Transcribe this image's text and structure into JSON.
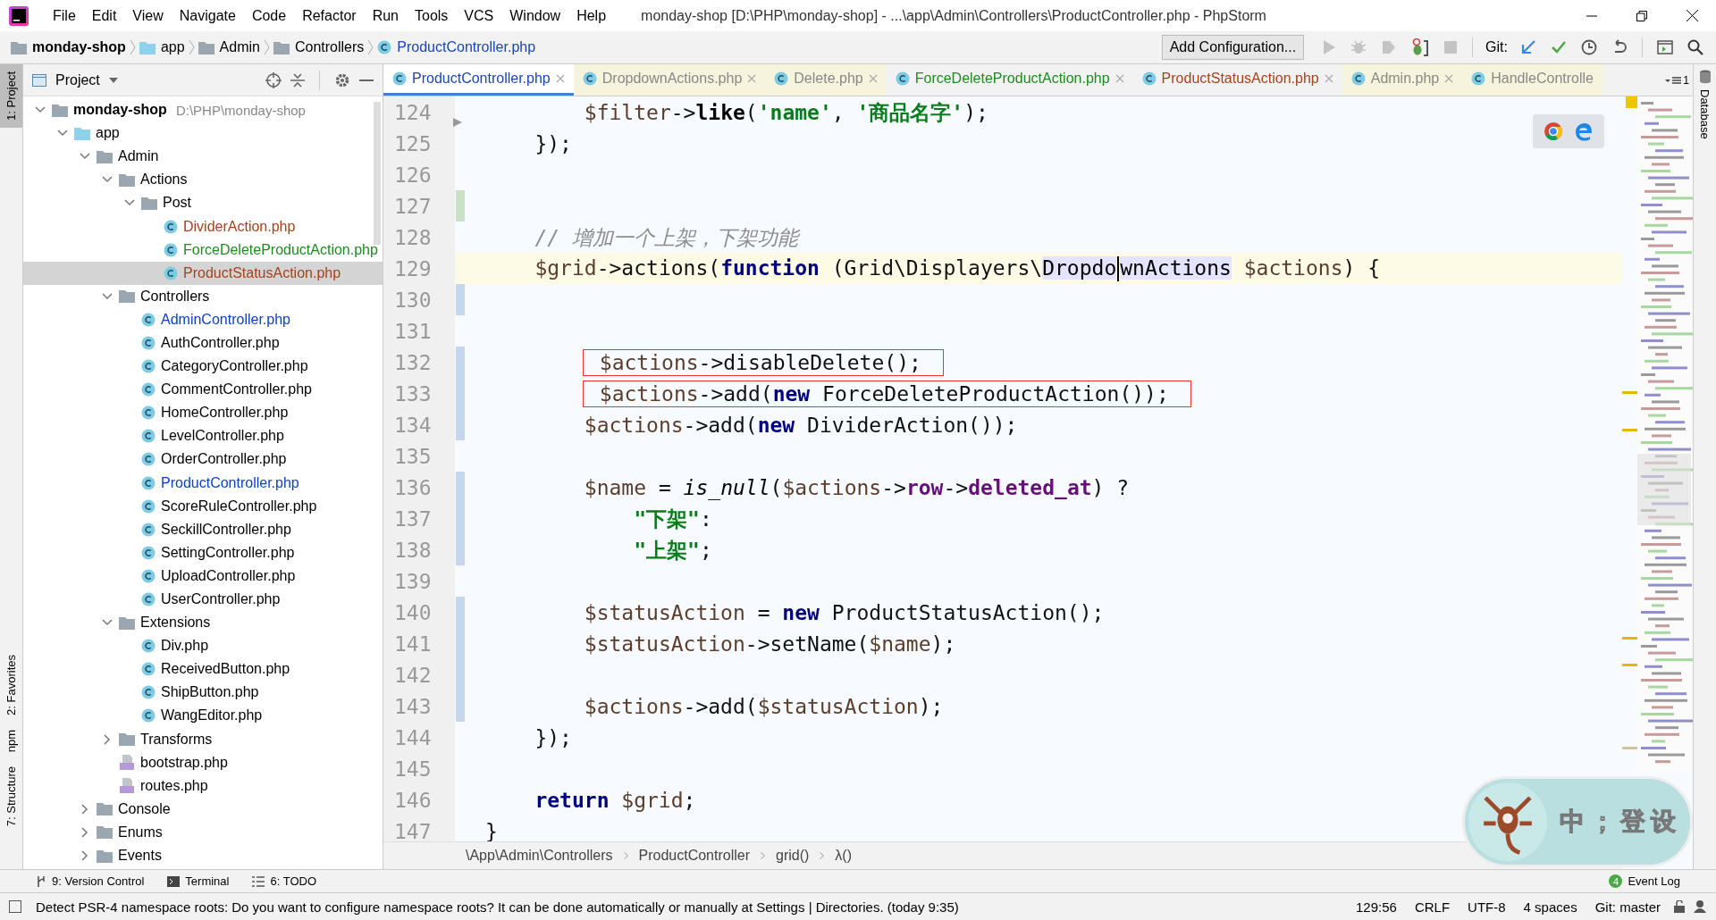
{
  "window": {
    "title": "monday-shop [D:\\PHP\\monday-shop] - ...\\app\\Admin\\Controllers\\ProductController.php - PhpStorm"
  },
  "menu": [
    "File",
    "Edit",
    "View",
    "Navigate",
    "Code",
    "Refactor",
    "Run",
    "Tools",
    "VCS",
    "Window",
    "Help"
  ],
  "navbar": [
    {
      "label": "monday-shop",
      "kind": "folder"
    },
    {
      "label": "app",
      "kind": "source-folder"
    },
    {
      "label": "Admin",
      "kind": "folder"
    },
    {
      "label": "Controllers",
      "kind": "folder"
    },
    {
      "label": "ProductController.php",
      "kind": "class"
    }
  ],
  "toolbar": {
    "config_button": "Add Configuration...",
    "git_label": "Git:"
  },
  "left_stripe": [
    {
      "label": "1: Project",
      "selected": true
    },
    {
      "label": "2: Favorites",
      "selected": false
    },
    {
      "label": "npm",
      "selected": false
    },
    {
      "label": "7: Structure",
      "selected": false
    }
  ],
  "right_stripe": [
    {
      "label": "Database"
    }
  ],
  "project_panel": {
    "title": "Project",
    "tree": [
      {
        "name": "monday-shop",
        "path": "D:\\PHP\\monday-shop",
        "kind": "folder",
        "expanded": true,
        "selected": false,
        "color": "#000000",
        "children": [
          {
            "name": "app",
            "kind": "source-folder",
            "expanded": true,
            "selected": false,
            "color": "#000000",
            "children": [
              {
                "name": "Admin",
                "kind": "folder",
                "expanded": true,
                "selected": false,
                "color": "#000000",
                "children": [
                  {
                    "name": "Actions",
                    "kind": "folder",
                    "expanded": true,
                    "selected": false,
                    "color": "#000000",
                    "children": [
                      {
                        "name": "Post",
                        "kind": "folder",
                        "expanded": true,
                        "selected": false,
                        "color": "#000000",
                        "children": [
                          {
                            "name": "DividerAction.php",
                            "kind": "class",
                            "selected": false,
                            "color": "#a5421b"
                          },
                          {
                            "name": "ForceDeleteProductAction.php",
                            "kind": "class",
                            "selected": false,
                            "color": "#1f8a1f"
                          },
                          {
                            "name": "ProductStatusAction.php",
                            "kind": "class",
                            "selected": true,
                            "color": "#a5421b"
                          }
                        ]
                      }
                    ]
                  },
                  {
                    "name": "Controllers",
                    "kind": "folder",
                    "expanded": true,
                    "selected": false,
                    "color": "#000000",
                    "children": [
                      {
                        "name": "AdminController.php",
                        "kind": "class",
                        "selected": false,
                        "color": "#0a3fc8"
                      },
                      {
                        "name": "AuthController.php",
                        "kind": "class",
                        "selected": false,
                        "color": "#000000"
                      },
                      {
                        "name": "CategoryController.php",
                        "kind": "class",
                        "selected": false,
                        "color": "#000000"
                      },
                      {
                        "name": "CommentController.php",
                        "kind": "class",
                        "selected": false,
                        "color": "#000000"
                      },
                      {
                        "name": "HomeController.php",
                        "kind": "class",
                        "selected": false,
                        "color": "#000000"
                      },
                      {
                        "name": "LevelController.php",
                        "kind": "class",
                        "selected": false,
                        "color": "#000000"
                      },
                      {
                        "name": "OrderController.php",
                        "kind": "class",
                        "selected": false,
                        "color": "#000000"
                      },
                      {
                        "name": "ProductController.php",
                        "kind": "class",
                        "selected": false,
                        "color": "#0a3fc8"
                      },
                      {
                        "name": "ScoreRuleController.php",
                        "kind": "class",
                        "selected": false,
                        "color": "#000000"
                      },
                      {
                        "name": "SeckillController.php",
                        "kind": "class",
                        "selected": false,
                        "color": "#000000"
                      },
                      {
                        "name": "SettingController.php",
                        "kind": "class",
                        "selected": false,
                        "color": "#000000"
                      },
                      {
                        "name": "UploadController.php",
                        "kind": "class",
                        "selected": false,
                        "color": "#000000"
                      },
                      {
                        "name": "UserController.php",
                        "kind": "class",
                        "selected": false,
                        "color": "#000000"
                      }
                    ]
                  },
                  {
                    "name": "Extensions",
                    "kind": "folder",
                    "expanded": true,
                    "selected": false,
                    "color": "#000000",
                    "children": [
                      {
                        "name": "Div.php",
                        "kind": "class",
                        "selected": false,
                        "color": "#000000"
                      },
                      {
                        "name": "ReceivedButton.php",
                        "kind": "class",
                        "selected": false,
                        "color": "#000000"
                      },
                      {
                        "name": "ShipButton.php",
                        "kind": "class",
                        "selected": false,
                        "color": "#000000"
                      },
                      {
                        "name": "WangEditor.php",
                        "kind": "class",
                        "selected": false,
                        "color": "#000000"
                      }
                    ]
                  },
                  {
                    "name": "Transforms",
                    "kind": "folder",
                    "expanded": false,
                    "selected": false,
                    "color": "#000000"
                  },
                  {
                    "name": "bootstrap.php",
                    "kind": "php",
                    "selected": false,
                    "color": "#000000"
                  },
                  {
                    "name": "routes.php",
                    "kind": "php",
                    "selected": false,
                    "color": "#000000"
                  }
                ]
              },
              {
                "name": "Console",
                "kind": "folder",
                "expanded": false,
                "selected": false,
                "color": "#000000"
              },
              {
                "name": "Enums",
                "kind": "folder",
                "expanded": false,
                "selected": false,
                "color": "#000000"
              },
              {
                "name": "Events",
                "kind": "folder",
                "expanded": false,
                "selected": false,
                "color": "#000000"
              }
            ]
          }
        ]
      }
    ]
  },
  "tabs": [
    {
      "label": "ProductController.php",
      "selected": true,
      "color": "#1c45b8",
      "kind": "project"
    },
    {
      "label": "DropdownActions.php",
      "selected": false,
      "color": "#888888",
      "kind": "library"
    },
    {
      "label": "Delete.php",
      "selected": false,
      "color": "#888888",
      "kind": "library"
    },
    {
      "label": "ForceDeleteProductAction.php",
      "selected": false,
      "color": "#1f8a1f",
      "kind": "project"
    },
    {
      "label": "ProductStatusAction.php",
      "selected": false,
      "color": "#a5421b",
      "kind": "project"
    },
    {
      "label": "Admin.php",
      "selected": false,
      "color": "#888888",
      "kind": "library"
    },
    {
      "label": "HandleControlle",
      "selected": false,
      "color": "#888888",
      "kind": "library"
    }
  ],
  "tab_overflow": "1",
  "editor": {
    "lines": [
      {
        "children": [
          {
            "children": [
              {
                "children": [
                  {
                    "number": "124",
                    "current": false,
                    "tokens": [
                      {
                        "text": "$filter",
                        "kind": "var"
                      },
                      {
                        "text": "->",
                        "kind": "plain"
                      },
                      {
                        "text": "like",
                        "kind": "bold"
                      },
                      {
                        "text": "(",
                        "kind": "plain"
                      },
                      {
                        "text": "'name'",
                        "kind": "str"
                      },
                      {
                        "text": ", ",
                        "kind": "plain"
                      },
                      {
                        "text": "'商品名字'",
                        "kind": "str"
                      },
                      {
                        "text": ");",
                        "kind": "plain"
                      }
                    ]
                  }
                ]
              },
              {
                "number": "125",
                "current": false,
                "tokens": [
                  {
                    "text": "});",
                    "kind": "plain"
                  }
                ]
              },
              {
                "number": "126",
                "current": false
              },
              {
                "number": "127",
                "color": "#c9e1c5",
                "current": false
              },
              {
                "number": "128",
                "current": false,
                "tokens": [
                  {
                    "text": "// 增加一个上架，下架功能",
                    "kind": "comment"
                  }
                ]
              },
              {
                "number": "129",
                "current": true,
                "tokens": [
                  {
                    "text": "$grid",
                    "kind": "var"
                  },
                  {
                    "text": "->actions(",
                    "kind": "plain"
                  },
                  {
                    "text": "function",
                    "kind": "kw"
                  },
                  {
                    "text": " (Grid\\Displayers\\",
                    "kind": "plain"
                  },
                  {
                    "text": "Dropdo",
                    "kind": "usage",
                    "caret": true
                  },
                  {
                    "text": "wnActions",
                    "kind": "usage"
                  },
                  {
                    "text": " $actions",
                    "kind": "var"
                  },
                  {
                    "text": ") {",
                    "kind": "plain"
                  }
                ]
              },
              {
                "children": [
                  {
                    "number": "130",
                    "color": "#c5d7ec",
                    "current": false
                  },
                  {
                    "number": "131",
                    "current": false
                  },
                  {
                    "number": "132",
                    "color": "#c5d7ec",
                    "current": false,
                    "boxed": true,
                    "tokens": [
                      {
                        "text": "$actions",
                        "kind": "var"
                      },
                      {
                        "text": "->disableDelete();",
                        "kind": "plain"
                      }
                    ]
                  },
                  {
                    "number": "133",
                    "color": "#c5d7ec",
                    "current": false,
                    "boxed": true,
                    "tokens": [
                      {
                        "text": "$actions",
                        "kind": "var"
                      },
                      {
                        "text": "->add(",
                        "kind": "plain"
                      },
                      {
                        "text": "new",
                        "kind": "kw"
                      },
                      {
                        "text": " ForceDeleteProductAction());",
                        "kind": "plain"
                      }
                    ]
                  },
                  {
                    "number": "134",
                    "color": "#c5d7ec",
                    "current": false,
                    "tokens": [
                      {
                        "text": "$actions",
                        "kind": "var"
                      },
                      {
                        "text": "->add(",
                        "kind": "plain"
                      },
                      {
                        "text": "new",
                        "kind": "kw"
                      },
                      {
                        "text": " DividerAction());",
                        "kind": "plain"
                      }
                    ]
                  },
                  {
                    "number": "135",
                    "current": false
                  },
                  {
                    "number": "136",
                    "color": "#c5d7ec",
                    "current": false,
                    "tokens": [
                      {
                        "text": "$name",
                        "kind": "var"
                      },
                      {
                        "text": " = ",
                        "kind": "plain"
                      },
                      {
                        "text": "is_null",
                        "kind": "italic"
                      },
                      {
                        "text": "(",
                        "kind": "plain"
                      },
                      {
                        "text": "$actions",
                        "kind": "var"
                      },
                      {
                        "text": "->",
                        "kind": "plain"
                      },
                      {
                        "text": "row",
                        "kind": "prop"
                      },
                      {
                        "text": "->",
                        "kind": "plain"
                      },
                      {
                        "text": "deleted_at",
                        "kind": "prop"
                      },
                      {
                        "text": ") ?",
                        "kind": "plain"
                      }
                    ]
                  },
                  {
                    "children": [
                      {
                        "number": "137",
                        "color": "#c5d7ec",
                        "current": false,
                        "tokens": [
                          {
                            "text": "\"下架\"",
                            "kind": "str"
                          },
                          {
                            "text": ":",
                            "kind": "plain"
                          }
                        ]
                      },
                      {
                        "number": "138",
                        "color": "#c5d7ec",
                        "current": false,
                        "tokens": [
                          {
                            "text": "\"上架\"",
                            "kind": "str"
                          },
                          {
                            "text": ";",
                            "kind": "plain"
                          }
                        ]
                      }
                    ]
                  },
                  {
                    "number": "139",
                    "current": false
                  },
                  {
                    "number": "140",
                    "color": "#c5d7ec",
                    "current": false,
                    "tokens": [
                      {
                        "text": "$statusAction",
                        "kind": "var"
                      },
                      {
                        "text": " = ",
                        "kind": "plain"
                      },
                      {
                        "text": "new",
                        "kind": "kw"
                      },
                      {
                        "text": " ProductStatusAction();",
                        "kind": "plain"
                      }
                    ]
                  },
                  {
                    "number": "141",
                    "color": "#c5d7ec",
                    "current": false,
                    "tokens": [
                      {
                        "text": "$statusAction",
                        "kind": "var"
                      },
                      {
                        "text": "->setName(",
                        "kind": "plain"
                      },
                      {
                        "text": "$name",
                        "kind": "var"
                      },
                      {
                        "text": ");",
                        "kind": "plain"
                      }
                    ]
                  },
                  {
                    "number": "142",
                    "color": "#c5d7ec",
                    "current": false
                  },
                  {
                    "number": "143",
                    "color": "#c5d7ec",
                    "current": false,
                    "tokens": [
                      {
                        "text": "$actions",
                        "kind": "var"
                      },
                      {
                        "text": "->add(",
                        "kind": "plain"
                      },
                      {
                        "text": "$statusAction",
                        "kind": "var"
                      },
                      {
                        "text": ");",
                        "kind": "plain"
                      }
                    ]
                  }
                ]
              },
              {
                "number": "144",
                "current": false,
                "tokens": [
                  {
                    "text": "});",
                    "kind": "plain"
                  }
                ]
              },
              {
                "number": "145",
                "current": false
              },
              {
                "number": "146",
                "current": false,
                "tokens": [
                  {
                    "text": "return",
                    "kind": "kw"
                  },
                  {
                    "text": " $grid",
                    "kind": "var"
                  },
                  {
                    "text": ";",
                    "kind": "plain"
                  }
                ]
              }
            ]
          },
          {
            "number": "147",
            "current": false,
            "tokens": [
              {
                "text": "}",
                "kind": "plain"
              }
            ]
          }
        ]
      }
    ],
    "breadcrumb": [
      "\\App\\Admin\\Controllers",
      "ProductController",
      "grid()",
      "λ()"
    ]
  },
  "ime_widget": {
    "keys": [
      "中",
      "；",
      "登",
      "设"
    ]
  },
  "tool_windows": [
    {
      "label": "9: Version Control",
      "kind": "vcs"
    },
    {
      "label": "Terminal",
      "kind": "terminal"
    },
    {
      "label": "6: TODO",
      "kind": "todo"
    }
  ],
  "event_log": {
    "label": "Event Log",
    "count": "4"
  },
  "status_bar": {
    "message": "Detect PSR-4 namespace roots: Do you want to configure namespace roots? It can be done automatically or manually at Settings | Directories. (today 9:35)",
    "items": [
      "129:56",
      "CRLF",
      "UTF-8",
      "4 spaces",
      "Git: master"
    ]
  }
}
